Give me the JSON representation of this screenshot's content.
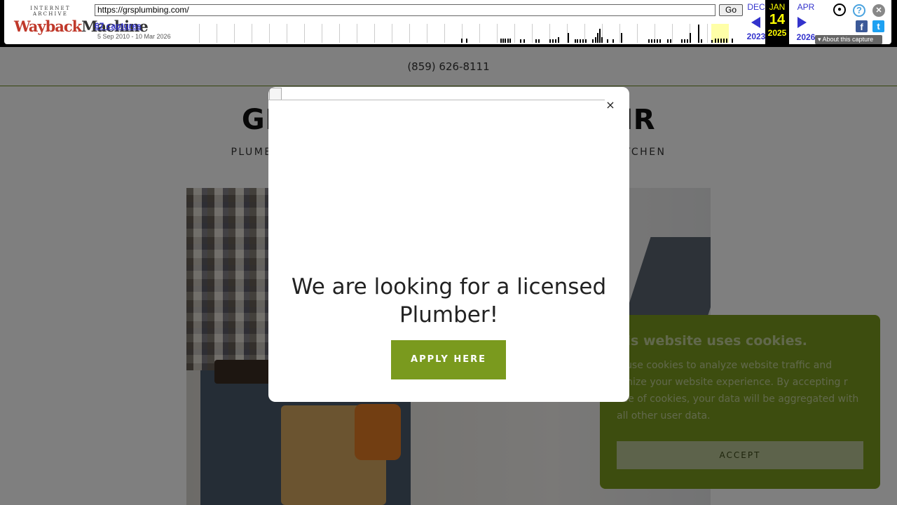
{
  "wayback": {
    "logo_top": "INTERNET ARCHIVE",
    "logo_main_1": "Wayback",
    "logo_main_2": "Machine",
    "url": "https://grsplumbing.com/",
    "go_label": "Go",
    "captures": "67 captures",
    "date_range": "5 Sep 2010 - 10 Mar 2026",
    "prev_month": "DEC",
    "prev_year": "2023",
    "current_month": "JAN",
    "current_day": "14",
    "current_year": "2025",
    "next_month": "APR",
    "next_year": "2026",
    "about_label": "About this capture",
    "help_glyph": "?",
    "close_glyph": "✕",
    "facebook_glyph": "f",
    "twitter_glyph": "t",
    "user_glyph": "●"
  },
  "site": {
    "phone": "(859) 626-8111",
    "title_left": "GRS",
    "title_right": "D AIR",
    "subtitle_left": "PLUMBIN",
    "subtitle_right": "ITCHEN"
  },
  "modal": {
    "heading": "We are looking for a licensed Plumber!",
    "button": "APPLY HERE",
    "close": "×"
  },
  "cookie": {
    "title": "his website uses cookies.",
    "text": "e use cookies to analyze website traffic and timize your website experience. By accepting r use of cookies, your data will be aggregated with all other user data.",
    "button": "ACCEPT"
  },
  "colors": {
    "accent": "#7a9a1e",
    "wayback_link": "#3333cc",
    "wayback_current": "#ffff00"
  }
}
